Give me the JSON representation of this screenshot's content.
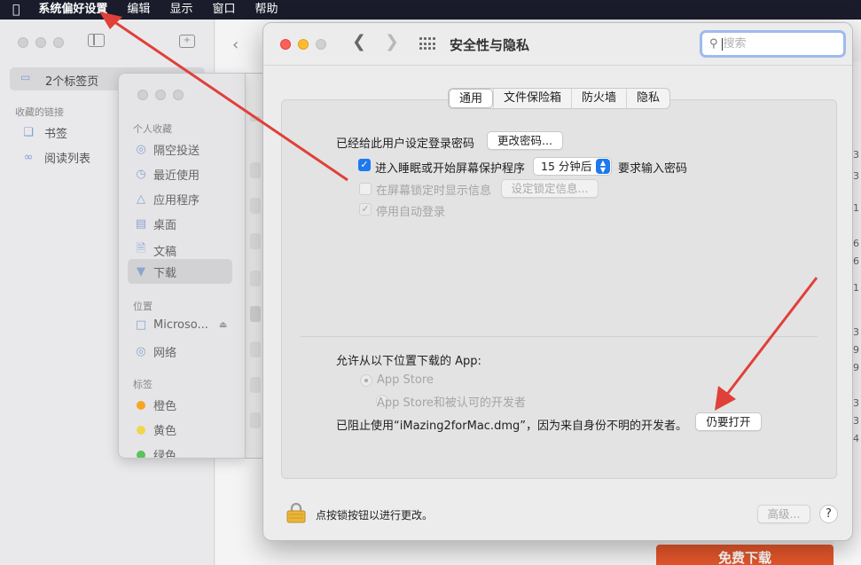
{
  "menubar": {
    "apple": "",
    "items": [
      "系统偏好设置",
      "编辑",
      "显示",
      "窗口",
      "帮助"
    ]
  },
  "browser": {
    "tab_group_label": "2个标签页",
    "links_header": "收藏的链接",
    "bookmarks": "书签",
    "reading_list": "阅读列表",
    "right_numbers": [
      "3",
      "3",
      "1",
      "6",
      "6",
      "1",
      "3",
      "9",
      "9",
      "3",
      "3",
      "4"
    ],
    "download_button": "免费下载"
  },
  "finder": {
    "favorites_header": "个人收藏",
    "favorites": [
      "隔空投送",
      "最近使用",
      "应用程序",
      "桌面",
      "文稿",
      "下载"
    ],
    "locations_header": "位置",
    "locations": [
      "Microso...",
      "网络"
    ],
    "tags_header": "标签",
    "tags": [
      {
        "label": "橙色",
        "color": "#f5a623"
      },
      {
        "label": "黄色",
        "color": "#f1d54b"
      },
      {
        "label": "绿色",
        "color": "#5ac35a"
      }
    ]
  },
  "prefs": {
    "title": "安全性与隐私",
    "search_placeholder": "搜索",
    "tabs": [
      "通用",
      "文件保险箱",
      "防火墙",
      "隐私"
    ],
    "active_tab": "通用",
    "password_set_label": "已经给此用户设定登录密码",
    "change_password_button": "更改密码...",
    "require_password_label": "进入睡眠或开始屏幕保护程序",
    "require_password_delay": "15 分钟后",
    "require_password_suffix": "要求输入密码",
    "show_message_label": "在屏幕锁定时显示信息",
    "set_lock_message_button": "设定锁定信息...",
    "disable_autologin_label": "停用自动登录",
    "allow_apps_label": "允许从以下位置下载的 App:",
    "app_store_option": "App Store",
    "app_store_identified_option": "App Store和被认可的开发者",
    "blocked_message": "已阻止使用“iMazing2forMac.dmg”，因为来自身份不明的开发者。",
    "open_anyway_button": "仍要打开",
    "lock_hint": "点按锁按钮以进行更改。",
    "advanced_button": "高级...",
    "help_button": "?"
  },
  "colors": {
    "accent": "#1e79f0",
    "annotation_arrow": "#e0403a",
    "download_button": "#e5572b"
  }
}
